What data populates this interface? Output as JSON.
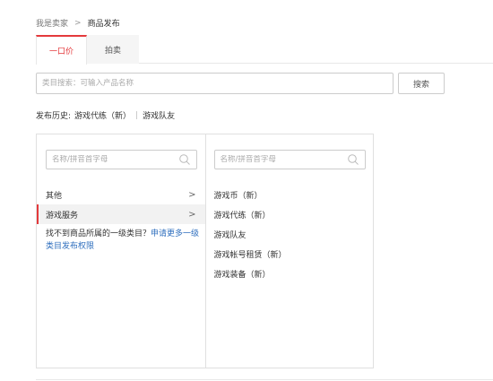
{
  "breadcrumb": {
    "parent": "我是卖家",
    "separator": ">",
    "current": "商品发布"
  },
  "tabs": [
    {
      "label": "一口价",
      "active": true
    },
    {
      "label": "拍卖",
      "active": false
    }
  ],
  "search": {
    "placeholder": "类目搜索：可输入产品名称",
    "value": "",
    "button_label": "搜索"
  },
  "history": {
    "label": "发布历史:",
    "items": [
      "游戏代练（新）",
      "游戏队友"
    ]
  },
  "left_column": {
    "search_placeholder": "名称/拼音首字母",
    "icon": "search-icon",
    "items": [
      {
        "label": "其他",
        "selected": false,
        "icon": "chevron-right-icon"
      },
      {
        "label": "游戏服务",
        "selected": true,
        "icon": "chevron-right-icon"
      }
    ],
    "hint_text": "找不到商品所属的一级类目？",
    "hint_link": "申请更多一级类目发布权限"
  },
  "right_column": {
    "search_placeholder": "名称/拼音首字母",
    "icon": "search-icon",
    "items": [
      "游戏币（新）",
      "游戏代练（新）",
      "游戏队友",
      "游戏帐号租赁（新）",
      "游戏装备（新）"
    ]
  },
  "colors": {
    "accent": "#e4393c",
    "link": "#2f6fbe",
    "border": "#e0e0e0"
  }
}
